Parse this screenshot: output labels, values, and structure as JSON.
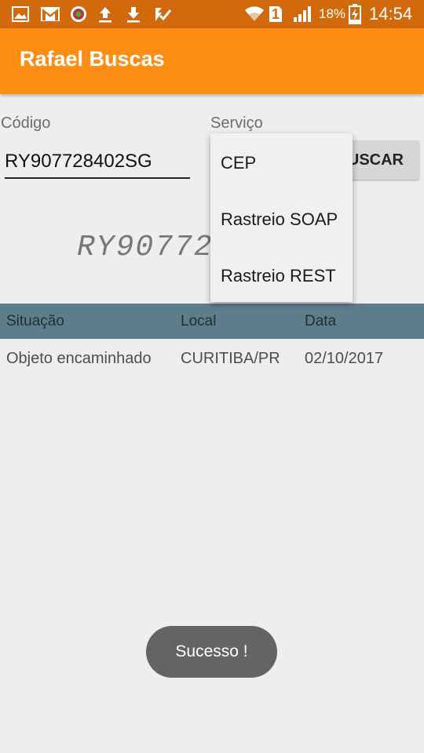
{
  "status_bar": {
    "battery_percent": "18%",
    "sim_slot": "1",
    "time": "14:54",
    "icons": [
      "gallery-icon",
      "gmail-icon",
      "app-badge-icon",
      "upload-icon",
      "download-icon",
      "check-icon",
      "wifi-icon",
      "signal-icon",
      "battery-charging-icon"
    ],
    "background_color": "#d06a0c"
  },
  "app_bar": {
    "title": "Rafael Buscas",
    "color": "#fd8d15"
  },
  "form": {
    "codigo_label": "Código",
    "codigo_value": "RY907728402SG",
    "servico_label": "Serviço",
    "buscar_label": "USCAR"
  },
  "barcode_text": "RY90772",
  "dropdown": {
    "items": [
      {
        "label": "CEP"
      },
      {
        "label": "Rastreio SOAP"
      },
      {
        "label": "Rastreio REST"
      }
    ]
  },
  "table": {
    "headers": [
      "Situação",
      "Local",
      "Data"
    ],
    "rows": [
      [
        "Objeto encaminhado",
        "CURITIBA/PR",
        "02/10/2017"
      ]
    ],
    "header_color": "#5e7d8a"
  },
  "toast": {
    "text": "Sucesso !"
  }
}
